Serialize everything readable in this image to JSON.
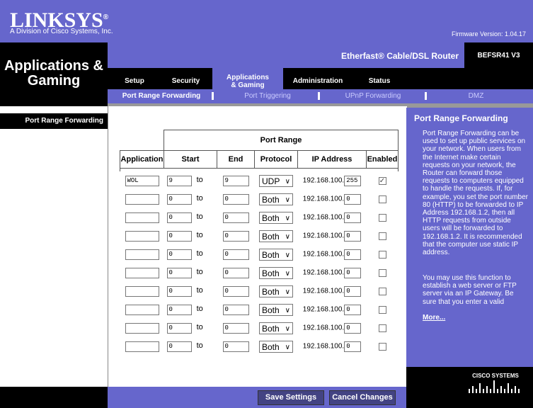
{
  "brand": {
    "logo": "LINKSYS",
    "reg": "®",
    "sub": "A Division of Cisco Systems, Inc."
  },
  "firmware": "Firmware Version: 1.04.17",
  "section": "Applications & Gaming",
  "product": {
    "name": "Etherfast® Cable/DSL Router",
    "model": "BEFSR41 V3"
  },
  "tabs": [
    "Setup",
    "Security",
    "Applications & Gaming",
    "Administration",
    "Status"
  ],
  "subtabs": [
    "Port Range Forwarding",
    "Port Triggering",
    "UPnP Forwarding",
    "DMZ"
  ],
  "left_label": "Port Range Forwarding",
  "table": {
    "group_header": "Port Range",
    "headers": [
      "Application",
      "Start",
      "End",
      "Protocol",
      "IP Address",
      "Enabled"
    ],
    "to_label": "to",
    "ip_prefix": "192.168.100.",
    "rows": [
      {
        "app": "WOL",
        "start": "9",
        "end": "9",
        "protocol": "UDP",
        "ip": "255",
        "enabled": true
      },
      {
        "app": "",
        "start": "0",
        "end": "0",
        "protocol": "Both",
        "ip": "0",
        "enabled": false
      },
      {
        "app": "",
        "start": "0",
        "end": "0",
        "protocol": "Both",
        "ip": "0",
        "enabled": false
      },
      {
        "app": "",
        "start": "0",
        "end": "0",
        "protocol": "Both",
        "ip": "0",
        "enabled": false
      },
      {
        "app": "",
        "start": "0",
        "end": "0",
        "protocol": "Both",
        "ip": "0",
        "enabled": false
      },
      {
        "app": "",
        "start": "0",
        "end": "0",
        "protocol": "Both",
        "ip": "0",
        "enabled": false
      },
      {
        "app": "",
        "start": "0",
        "end": "0",
        "protocol": "Both",
        "ip": "0",
        "enabled": false
      },
      {
        "app": "",
        "start": "0",
        "end": "0",
        "protocol": "Both",
        "ip": "0",
        "enabled": false
      },
      {
        "app": "",
        "start": "0",
        "end": "0",
        "protocol": "Both",
        "ip": "0",
        "enabled": false
      },
      {
        "app": "",
        "start": "0",
        "end": "0",
        "protocol": "Both",
        "ip": "0",
        "enabled": false
      }
    ]
  },
  "help": {
    "title": "Port Range Forwarding",
    "p1": "Port Range Forwarding can be used to set up public services on your network. When users from the Internet make certain requests on your network, the Router can forward those requests to computers equipped to handle the requests. If, for example, you set the port number 80 (HTTP) to be forwarded to IP Address 192.168.1.2, then all HTTP requests from outside users will be forwarded to 192.168.1.2. It is recommended that the computer use static IP address.",
    "p2": "You may use this function to establish a web server or FTP server via an IP Gateway. Be sure that you enter a valid",
    "more": "More..."
  },
  "cisco_label": "CISCO SYSTEMS",
  "buttons": {
    "save": "Save Settings",
    "cancel": "Cancel Changes"
  },
  "colors": {
    "accent": "#6666cc",
    "dark": "#000000",
    "button": "#434383"
  }
}
